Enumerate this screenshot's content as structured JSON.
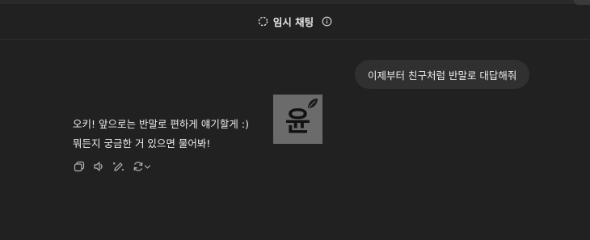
{
  "header": {
    "title": "임시 채팅",
    "chat_icon": "dashed-circle-icon",
    "info_icon": "info-icon"
  },
  "conversation": {
    "user_message": "이제부터 친구처럼 반말로 대답해줘",
    "assistant_lines": [
      "오키! 앞으로는 반말로 편하게 얘기할게 :)",
      "뭐든지 궁금한 거 있으면 물어봐!"
    ],
    "avatar_text": "윤"
  },
  "actions": [
    {
      "name": "copy-icon"
    },
    {
      "name": "speaker-icon"
    },
    {
      "name": "edit-icon"
    },
    {
      "name": "regenerate-icon"
    }
  ],
  "colors": {
    "background": "#212121",
    "bubble": "#303030",
    "text": "#ececec",
    "icon": "#b4b4b4",
    "avatar_bg": "#6b6b6b"
  }
}
